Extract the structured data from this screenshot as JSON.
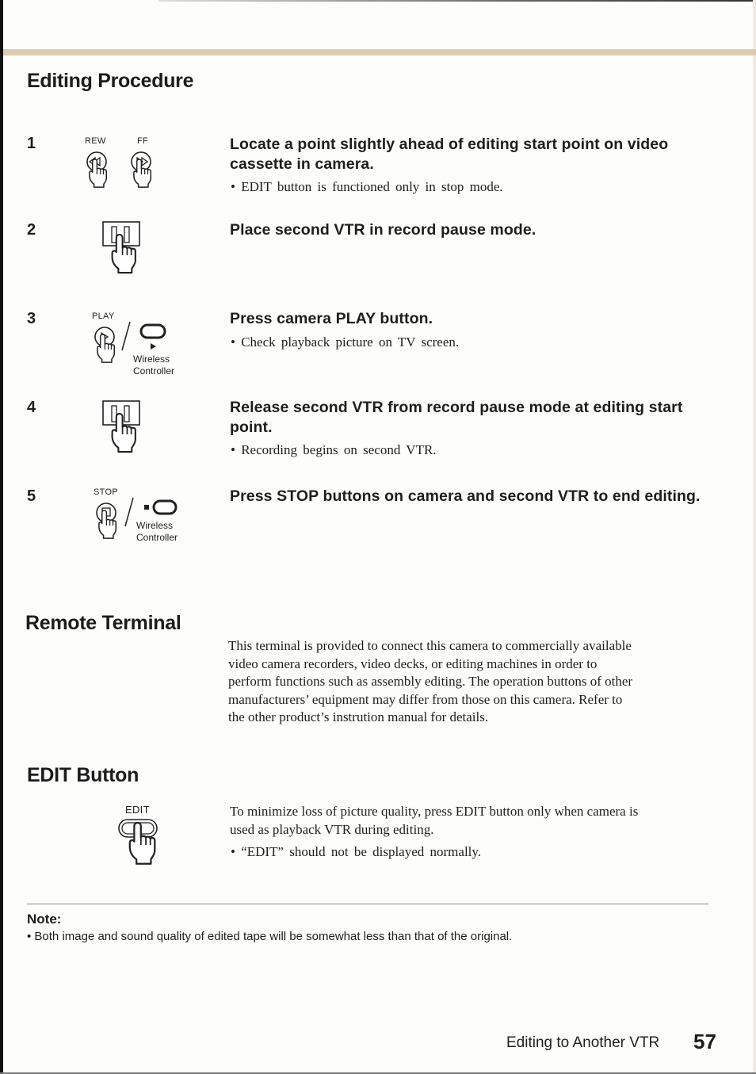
{
  "header": {
    "section_title": "Editing Procedure"
  },
  "steps": [
    {
      "number": "1",
      "illustration": {
        "labels": [
          "REW",
          "FF"
        ],
        "icon": "rew-ff-buttons-press"
      },
      "heading": "Locate a point slightly ahead of editing start point on video cassette in camera.",
      "bullets": [
        "EDIT button is functioned only in stop mode."
      ]
    },
    {
      "number": "2",
      "illustration": {
        "icon": "pause-button-press"
      },
      "heading": "Place second VTR in record pause mode.",
      "bullets": []
    },
    {
      "number": "3",
      "illustration": {
        "label": "PLAY",
        "alt_label": "Wireless Controller",
        "alt_line1": "Wireless",
        "alt_line2": "Controller",
        "icon": "play-button-press"
      },
      "heading": "Press camera PLAY button.",
      "bullets": [
        "Check playback picture on TV screen."
      ]
    },
    {
      "number": "4",
      "illustration": {
        "icon": "pause-button-press"
      },
      "heading": "Release second VTR from record pause mode at editing start point.",
      "bullets": [
        "Recording begins on second VTR."
      ]
    },
    {
      "number": "5",
      "illustration": {
        "label": "STOP",
        "alt_line1": "Wireless",
        "alt_line2": "Controller",
        "icon": "stop-button-press"
      },
      "heading": "Press STOP buttons on camera and second VTR to end editing.",
      "bullets": []
    }
  ],
  "remote_terminal": {
    "title": "Remote Terminal",
    "lines": [
      "This terminal is provided to connect this camera to commercially available",
      "video camera recorders, video decks, or editing machines in order to",
      "perform functions such as assembly editing. The operation buttons of other",
      "manufacturers’ equipment may differ from those on this camera. Refer to",
      "the other product’s instrution manual for details."
    ]
  },
  "edit_button": {
    "title": "EDIT Button",
    "illustration_label": "EDIT",
    "lines": [
      "To minimize loss of picture quality, press EDIT button only when camera is",
      "used as playback VTR during editing."
    ],
    "bullet": "“EDIT” should not be displayed normally."
  },
  "note": {
    "title": "Note:",
    "text": "Both image and sound quality of edited tape will be somewhat less than that of the original."
  },
  "footer": {
    "chapter_title": "Editing to Another VTR",
    "page_number": "57"
  },
  "colors": {
    "header_bar": "#dccbb0",
    "text": "#1e1e1e",
    "paper": "#fdfdfb"
  }
}
